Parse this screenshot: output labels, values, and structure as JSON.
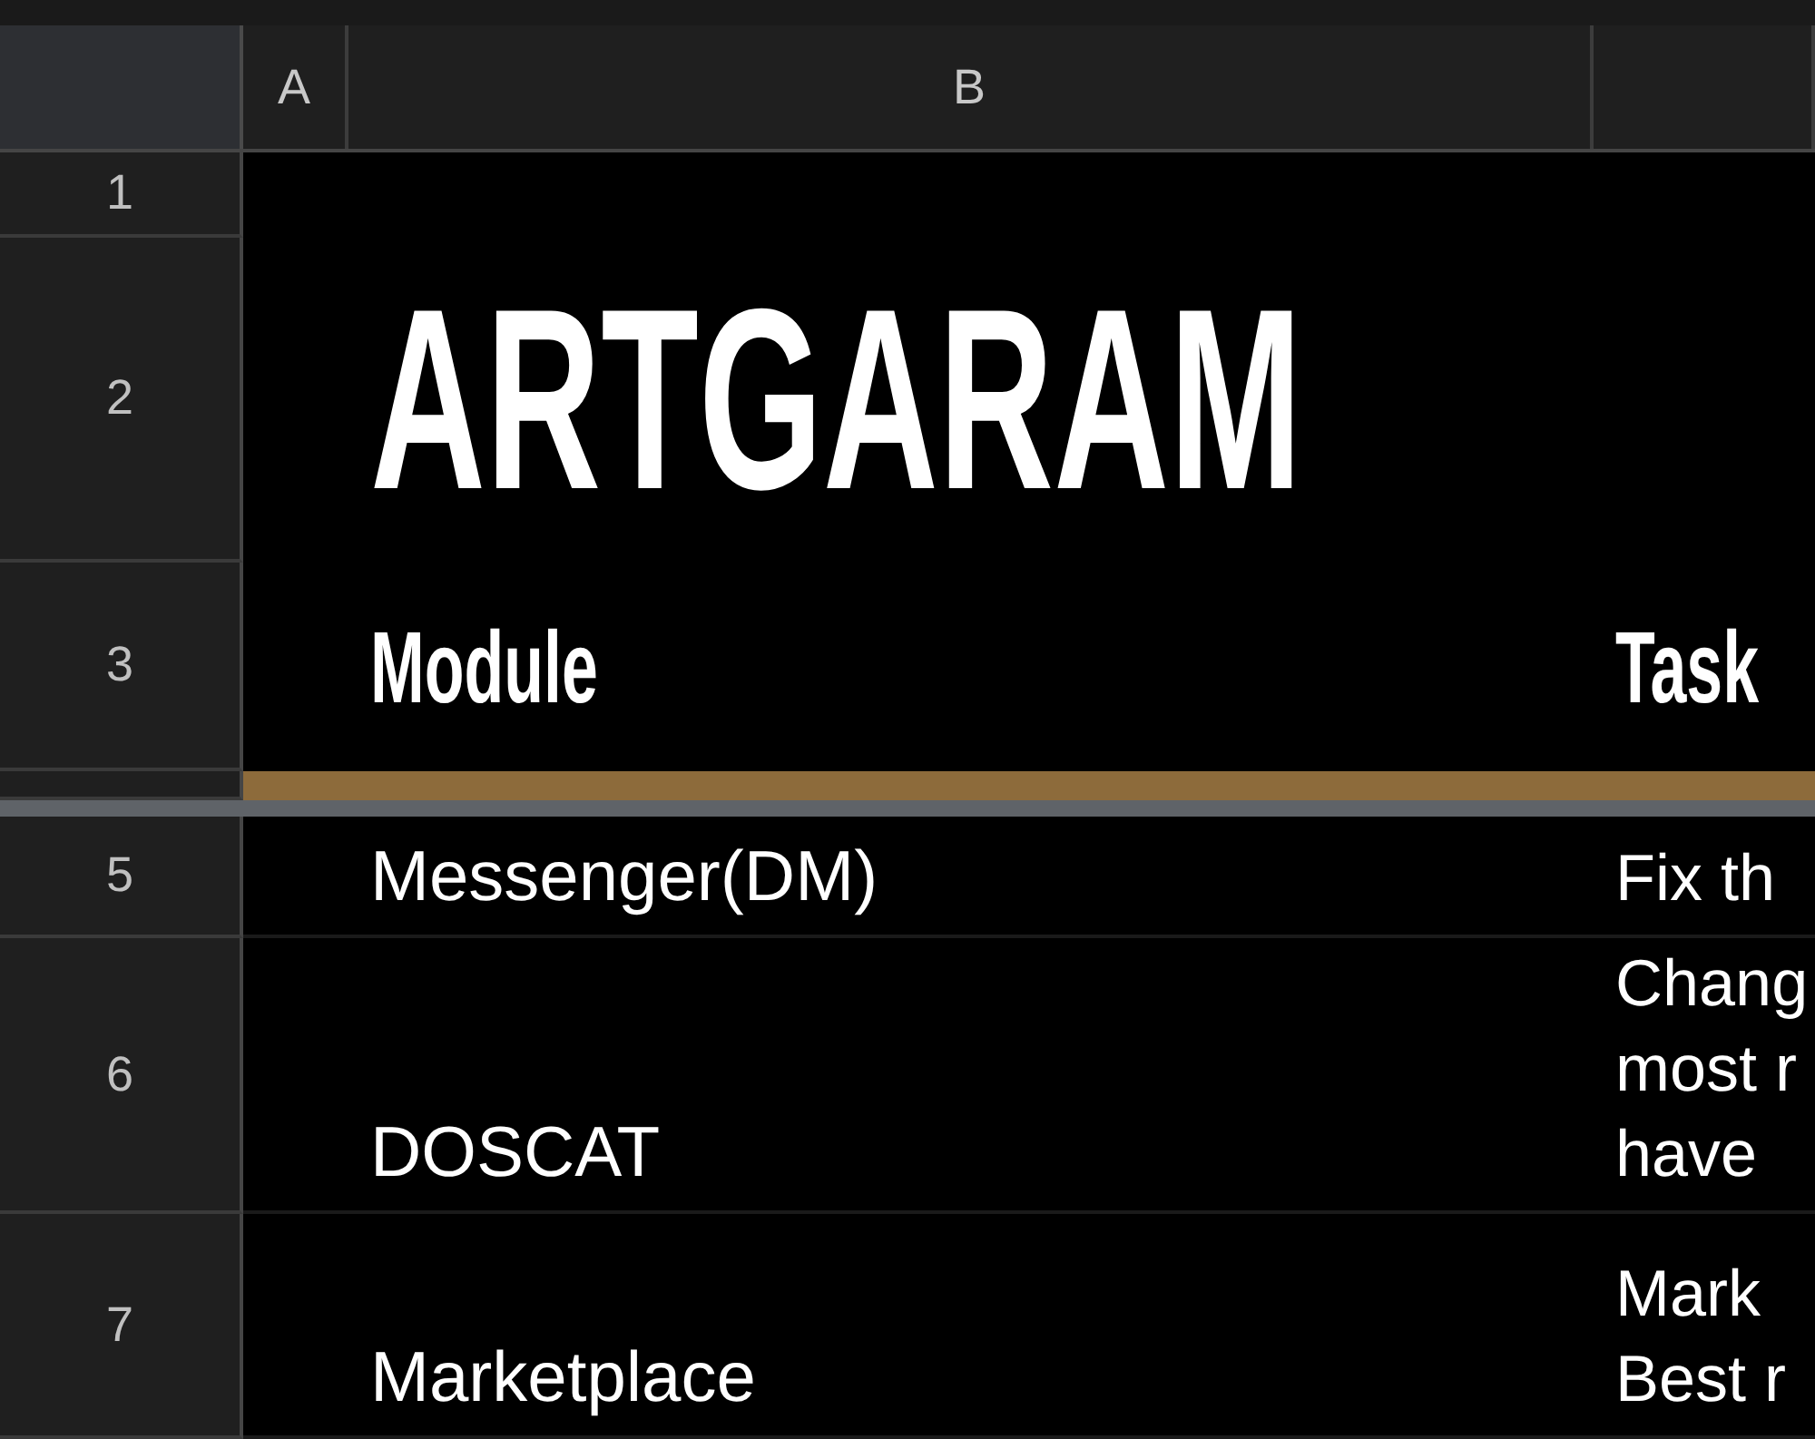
{
  "columns": [
    {
      "label": "A"
    },
    {
      "label": "B"
    }
  ],
  "rows": [
    {
      "kind": "blank",
      "number": "1"
    },
    {
      "kind": "title",
      "number": "2",
      "text": "ARTGARAM"
    },
    {
      "kind": "heading",
      "number": "3",
      "cells": [
        "Module",
        "Task"
      ]
    },
    {
      "kind": "band",
      "freeze_below": true
    },
    {
      "kind": "data",
      "number": "5",
      "module": "Messenger(DM)",
      "task": [
        "Fix th"
      ]
    },
    {
      "kind": "data",
      "number": "6",
      "module": "DOSCAT",
      "task": [
        "Chang",
        "most r",
        "have"
      ]
    },
    {
      "kind": "data",
      "number": "7",
      "module": "Marketplace",
      "task": [
        "Mark",
        "Best r"
      ]
    }
  ]
}
